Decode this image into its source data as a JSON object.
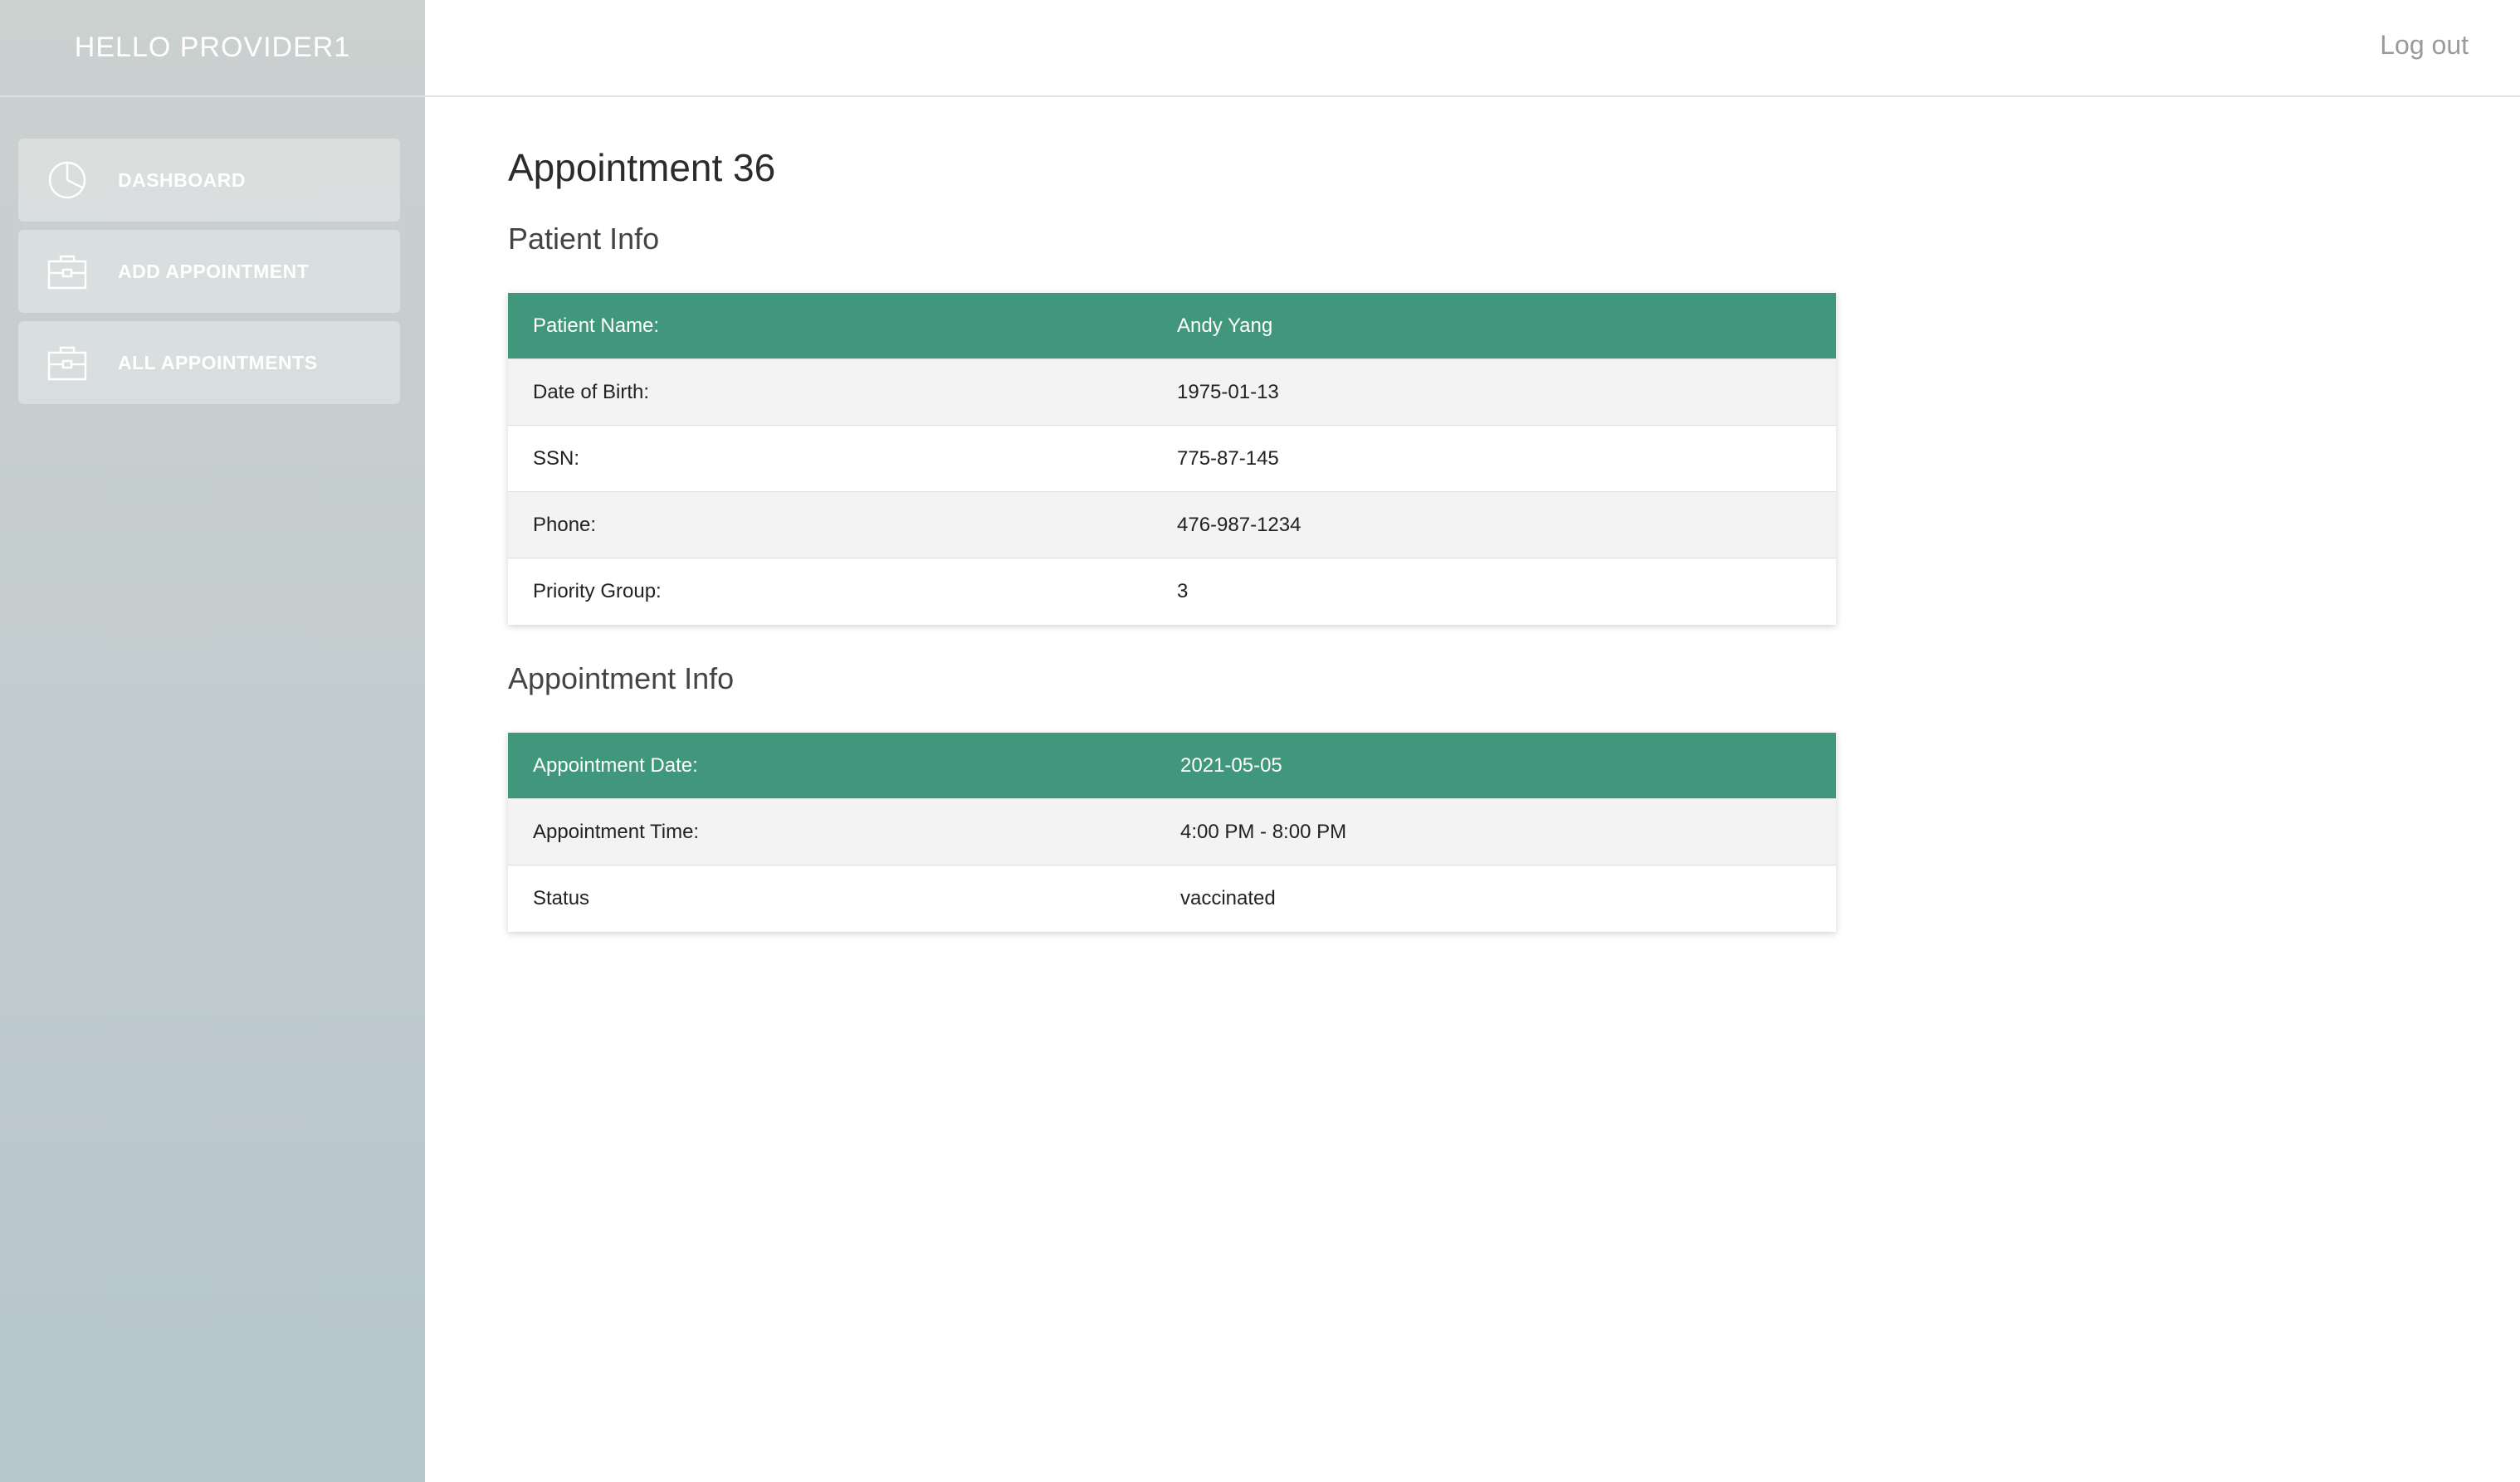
{
  "sidebar": {
    "greeting": "HELLO PROVIDER1",
    "items": [
      {
        "label": "DASHBOARD",
        "icon": "pie-chart-icon"
      },
      {
        "label": "ADD APPOINTMENT",
        "icon": "briefcase-icon"
      },
      {
        "label": "ALL APPOINTMENTS",
        "icon": "briefcase-icon"
      }
    ]
  },
  "topbar": {
    "logout_label": "Log out"
  },
  "main": {
    "title": "Appointment 36",
    "patient_section": {
      "title": "Patient Info",
      "rows": [
        {
          "label": "Patient Name:",
          "value": "Andy Yang"
        },
        {
          "label": "Date of Birth:",
          "value": "1975-01-13"
        },
        {
          "label": "SSN:",
          "value": "775-87-145"
        },
        {
          "label": "Phone:",
          "value": "476-987-1234"
        },
        {
          "label": "Priority Group:",
          "value": "3"
        }
      ]
    },
    "appointment_section": {
      "title": "Appointment Info",
      "rows": [
        {
          "label": "Appointment Date:",
          "value": "2021-05-05"
        },
        {
          "label": "Appointment Time:",
          "value": "4:00 PM - 8:00 PM"
        },
        {
          "label": "Status",
          "value": "vaccinated"
        }
      ]
    }
  },
  "colors": {
    "table_header": "#41977c",
    "row_shade": "#f3f3f3",
    "sidebar_top": "#cbd1cf",
    "sidebar_bottom": "#b6c6cd"
  }
}
